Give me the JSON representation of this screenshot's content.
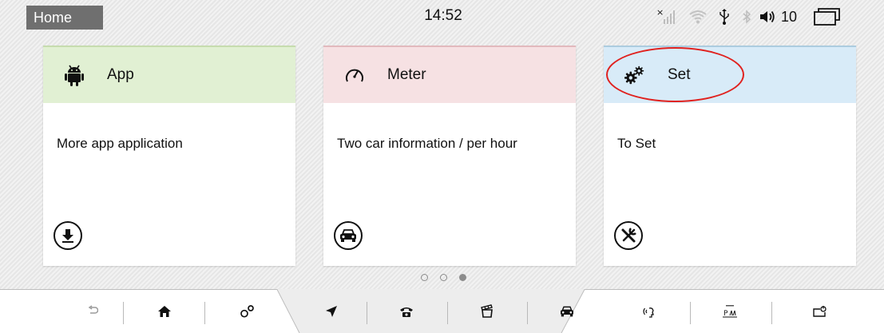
{
  "status_bar": {
    "home_label": "Home",
    "time": "14:52",
    "volume": "10",
    "icons": [
      "no-signal-icon",
      "wifi-icon",
      "usb-icon",
      "bluetooth-icon",
      "volume-icon",
      "window-icon"
    ]
  },
  "cards": [
    {
      "id": "app",
      "title": "App",
      "description": "More app application",
      "header_icon": "android-icon",
      "footer_icon": "download-icon",
      "color": "#e1f0d3"
    },
    {
      "id": "meter",
      "title": "Meter",
      "description": "Two car information / per hour",
      "header_icon": "speedometer-icon",
      "footer_icon": "car-icon",
      "color": "#f6e1e3"
    },
    {
      "id": "set",
      "title": "Set",
      "description": "To Set",
      "header_icon": "gears-icon",
      "footer_icon": "tools-icon",
      "color": "#d8ebf8"
    }
  ],
  "pagination": {
    "pages": 3,
    "active": 3
  },
  "bottom_nav": [
    "back-icon",
    "home-icon",
    "settings-icon",
    "navigation-icon",
    "phone-icon",
    "media-icon",
    "car-icon",
    "voice-icon",
    "parking-icon",
    "screen-off-icon"
  ],
  "colors": {
    "highlight": "#e0211e",
    "home_tab": "#6f6f6f"
  }
}
